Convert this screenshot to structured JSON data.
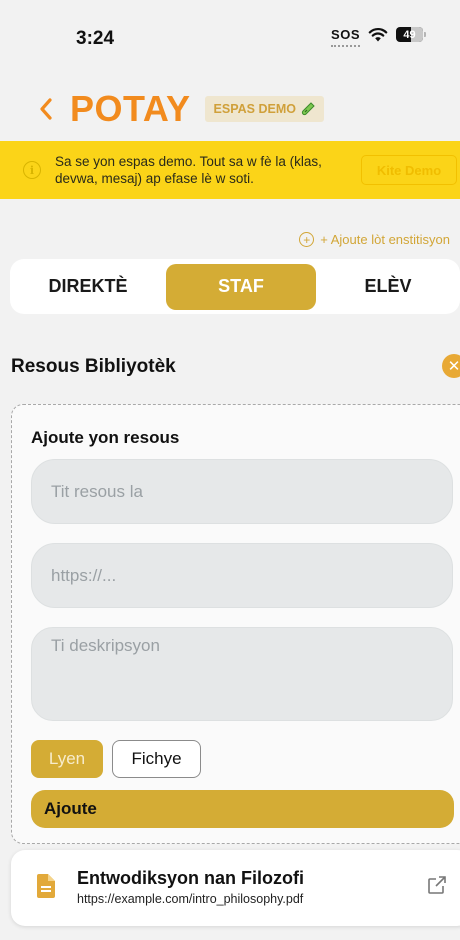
{
  "status_bar": {
    "time": "3:24",
    "sos": "SOS",
    "battery": "49",
    "battery_level": 0.49
  },
  "header": {
    "back_icon": "chevron-left-icon",
    "brand": "POTAY",
    "demo_badge": "ESPAS DEMO",
    "demo_badge_icon": "test-tube-icon"
  },
  "demo_banner": {
    "icon": "info-icon",
    "text": "Sa se yon espas demo. Tout sa w fè la (klas, devwa, mesaj) ap efase lè w soti.",
    "exit_button": "Kite Demo"
  },
  "add_institution": "+ Ajoute lòt enstitisyon",
  "tabs": [
    {
      "label": "DIREKTÈ",
      "active": false
    },
    {
      "label": "STAF",
      "active": true
    },
    {
      "label": "ELÈV",
      "active": false
    }
  ],
  "library": {
    "title": "Resous Bibliyotèk",
    "close_icon": "close-icon"
  },
  "form": {
    "title": "Ajoute yon resous",
    "title_placeholder": "Tit resous la",
    "url_placeholder": "https://...",
    "description_placeholder": "Ti deskripsyon",
    "type_link": "Lyen",
    "type_file": "Fichye",
    "selected_type": "Lyen",
    "submit": "Ajoute"
  },
  "resources": [
    {
      "title": "Entwodiksyon nan Filozofi",
      "url": "https://example.com/intro_philosophy.pdf",
      "icon": "document-icon",
      "action_icon": "external-link-icon"
    }
  ],
  "colors": {
    "brand": "#f28b1e",
    "accent_gold": "#d4ac35",
    "banner_yellow": "#fbd418",
    "close_orange": "#e8a935"
  }
}
